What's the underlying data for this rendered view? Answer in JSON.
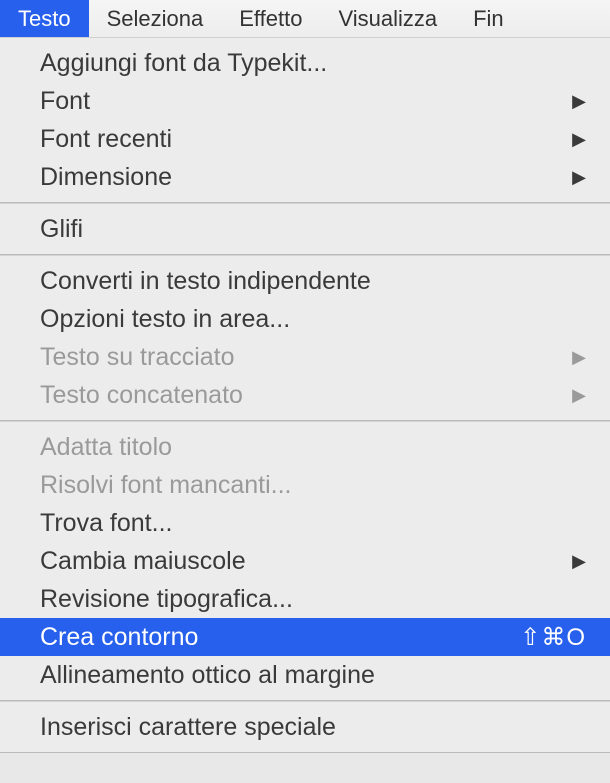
{
  "menubar": {
    "items": [
      {
        "label": "Testo",
        "active": true
      },
      {
        "label": "Seleziona",
        "active": false
      },
      {
        "label": "Effetto",
        "active": false
      },
      {
        "label": "Visualizza",
        "active": false
      },
      {
        "label": "Fin",
        "active": false
      }
    ]
  },
  "dropdown": {
    "sections": [
      {
        "items": [
          {
            "label": "Aggiungi font da Typekit...",
            "hasSubmenu": false,
            "disabled": false,
            "highlighted": false,
            "shortcut": ""
          },
          {
            "label": "Font",
            "hasSubmenu": true,
            "disabled": false,
            "highlighted": false,
            "shortcut": ""
          },
          {
            "label": "Font recenti",
            "hasSubmenu": true,
            "disabled": false,
            "highlighted": false,
            "shortcut": ""
          },
          {
            "label": "Dimensione",
            "hasSubmenu": true,
            "disabled": false,
            "highlighted": false,
            "shortcut": ""
          }
        ]
      },
      {
        "items": [
          {
            "label": "Glifi",
            "hasSubmenu": false,
            "disabled": false,
            "highlighted": false,
            "shortcut": ""
          }
        ]
      },
      {
        "items": [
          {
            "label": "Converti in testo indipendente",
            "hasSubmenu": false,
            "disabled": false,
            "highlighted": false,
            "shortcut": ""
          },
          {
            "label": "Opzioni testo in area...",
            "hasSubmenu": false,
            "disabled": false,
            "highlighted": false,
            "shortcut": ""
          },
          {
            "label": "Testo su tracciato",
            "hasSubmenu": true,
            "disabled": true,
            "highlighted": false,
            "shortcut": ""
          },
          {
            "label": "Testo concatenato",
            "hasSubmenu": true,
            "disabled": true,
            "highlighted": false,
            "shortcut": ""
          }
        ]
      },
      {
        "items": [
          {
            "label": "Adatta titolo",
            "hasSubmenu": false,
            "disabled": true,
            "highlighted": false,
            "shortcut": ""
          },
          {
            "label": "Risolvi font mancanti...",
            "hasSubmenu": false,
            "disabled": true,
            "highlighted": false,
            "shortcut": ""
          },
          {
            "label": "Trova font...",
            "hasSubmenu": false,
            "disabled": false,
            "highlighted": false,
            "shortcut": ""
          },
          {
            "label": "Cambia maiuscole",
            "hasSubmenu": true,
            "disabled": false,
            "highlighted": false,
            "shortcut": ""
          },
          {
            "label": "Revisione tipografica...",
            "hasSubmenu": false,
            "disabled": false,
            "highlighted": false,
            "shortcut": ""
          },
          {
            "label": "Crea contorno",
            "hasSubmenu": false,
            "disabled": false,
            "highlighted": true,
            "shortcut": "⇧⌘O"
          },
          {
            "label": "Allineamento ottico al margine",
            "hasSubmenu": false,
            "disabled": false,
            "highlighted": false,
            "shortcut": ""
          }
        ]
      },
      {
        "items": [
          {
            "label": "Inserisci carattere speciale",
            "hasSubmenu": false,
            "disabled": false,
            "highlighted": false,
            "shortcut": ""
          }
        ]
      }
    ]
  },
  "glyphs": {
    "submenuArrow": "▶"
  }
}
